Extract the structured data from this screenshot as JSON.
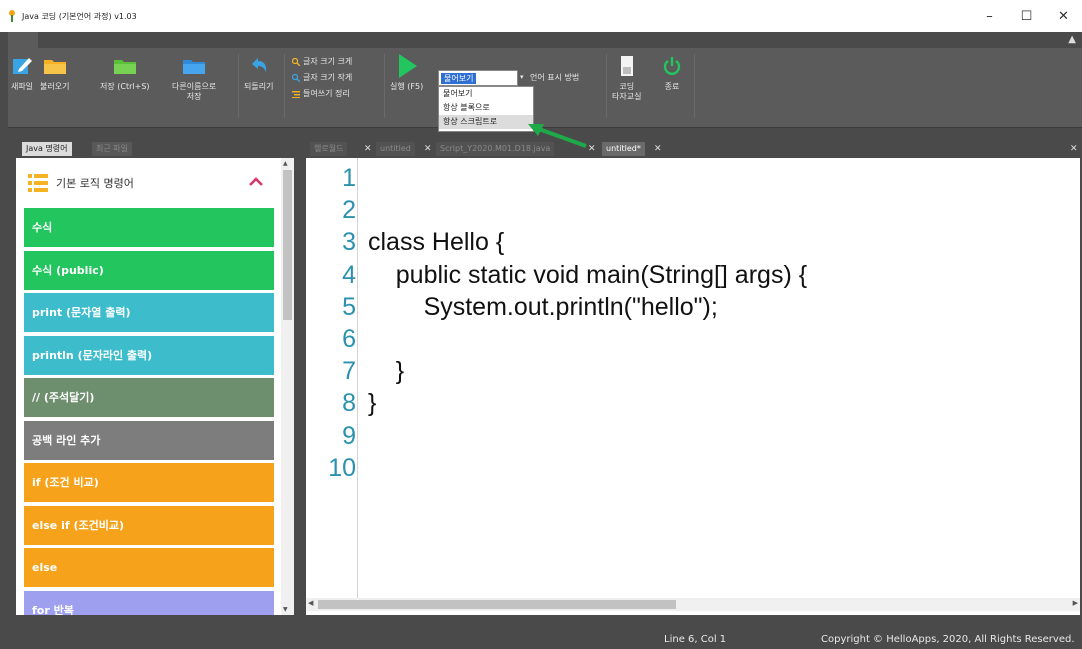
{
  "window": {
    "title": "Java 코딩 (기본언어 과정) v1.03",
    "minimize": "–",
    "maximize": "☐",
    "close": "✕"
  },
  "ribbon": {
    "new_file": "새파일",
    "open": "불러오기",
    "save": "저장 (Ctrl+S)",
    "save_as": "다른이름으로\n저장",
    "undo": "되돌리기",
    "font_bigger": "글자 크기 크게",
    "font_smaller": "글자 크기 작게",
    "indent": "들여쓰기 정리",
    "run": "실행 (F5)",
    "lang_label": "언어 표시 방법",
    "lang_selected": "물어보기",
    "lang_options": [
      "물어보기",
      "항상 블록으로",
      "항상 스크립트로"
    ],
    "tutor": "코딩\n타자교실",
    "exit": "종료"
  },
  "left_panel": {
    "tabs": [
      "Java 명령어",
      "최근 파일"
    ],
    "header": "기본 로직 명령어",
    "commands": [
      {
        "label": "수식",
        "color": "#22c55e"
      },
      {
        "label": "수식 (public)",
        "color": "#22c55e"
      },
      {
        "label": "print (문자열 출력)",
        "color": "#3dbccc"
      },
      {
        "label": "println (문자라인 출력)",
        "color": "#3dbccc"
      },
      {
        "label": "// (주석달기)",
        "color": "#6e8f6e"
      },
      {
        "label": "공백 라인 추가",
        "color": "#7d7d7d"
      },
      {
        "label": "if (조건 비교)",
        "color": "#f7a21b"
      },
      {
        "label": "else if (조건비교)",
        "color": "#f7a21b"
      },
      {
        "label": "else",
        "color": "#f7a21b"
      },
      {
        "label": "for 반복",
        "color": "#9f9ff0"
      }
    ]
  },
  "editor": {
    "tabs": [
      {
        "label": "헬로월드",
        "active": false
      },
      {
        "label": "untitled",
        "active": false
      },
      {
        "label": "Script_Y2020.M01.D18.java",
        "active": false
      },
      {
        "label": "untitled*",
        "active": true
      }
    ],
    "line_numbers": [
      "1",
      "2",
      "3",
      "4",
      "5",
      "6",
      "7",
      "8",
      "9",
      "10"
    ],
    "code_lines": [
      "",
      "",
      "class Hello {",
      "    public static void main(String[] args) {",
      "        System.out.println(\"hello\");",
      "",
      "    }",
      "}",
      "",
      ""
    ]
  },
  "status": {
    "position": "Line 6, Col 1",
    "copyright": "Copyright © HelloApps, 2020, All Rights Reserved."
  },
  "colors": {
    "ribbon_bg": "#5b5b5b",
    "chrome_bg": "#4a4a4a",
    "line_number": "#2b91af",
    "annotation_arrow": "#1faa4a",
    "run_green": "#22c55e"
  }
}
